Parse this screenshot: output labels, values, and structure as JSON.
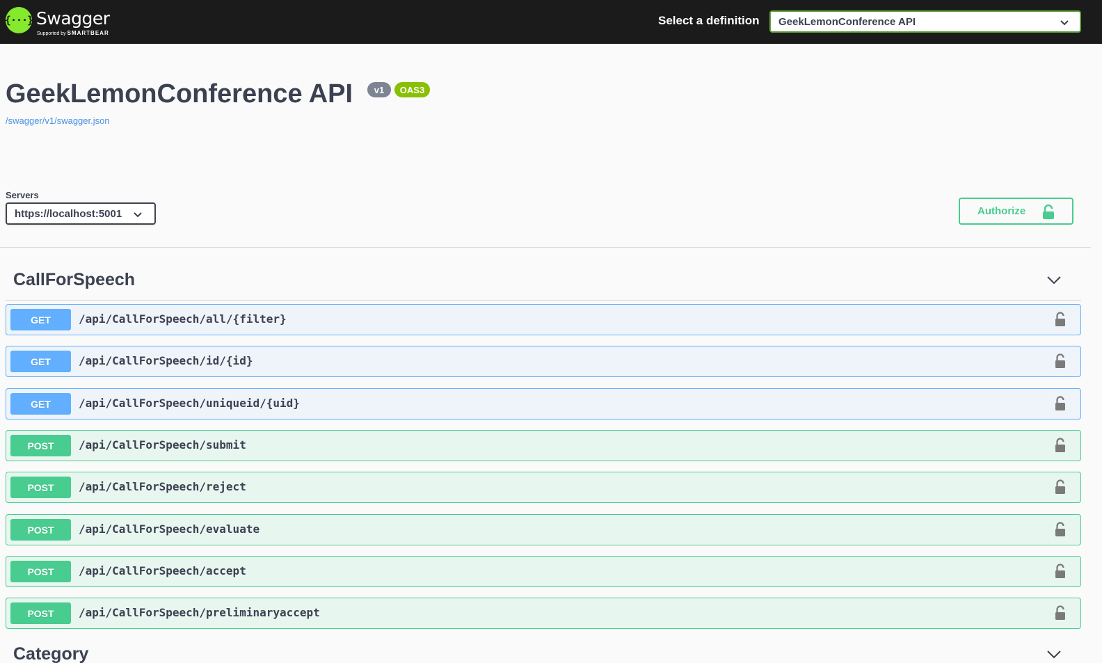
{
  "topbar": {
    "logo_title": "Swagger",
    "logo_supported": "Supported by",
    "logo_brand": "SMARTBEAR",
    "logo_glyph": "{···}",
    "definition_label": "Select a definition",
    "definition_value": "GeekLemonConference API"
  },
  "info": {
    "title": "GeekLemonConference API",
    "version_badge": "v1",
    "spec_badge": "OAS3",
    "spec_link": "/swagger/v1/swagger.json"
  },
  "servers": {
    "label": "Servers",
    "selected": "https://localhost:5001"
  },
  "authorize": {
    "label": "Authorize"
  },
  "tags": [
    {
      "name": "CallForSpeech",
      "operations": [
        {
          "method": "GET",
          "path": "/api/CallForSpeech/all/{filter}"
        },
        {
          "method": "GET",
          "path": "/api/CallForSpeech/id/{id}"
        },
        {
          "method": "GET",
          "path": "/api/CallForSpeech/uniqueid/{uid}"
        },
        {
          "method": "POST",
          "path": "/api/CallForSpeech/submit"
        },
        {
          "method": "POST",
          "path": "/api/CallForSpeech/reject"
        },
        {
          "method": "POST",
          "path": "/api/CallForSpeech/evaluate"
        },
        {
          "method": "POST",
          "path": "/api/CallForSpeech/accept"
        },
        {
          "method": "POST",
          "path": "/api/CallForSpeech/preliminaryaccept"
        }
      ]
    },
    {
      "name": "Category",
      "operations": []
    }
  ],
  "colors": {
    "topbar": "#1b1b1b",
    "logo": "#85ea2d",
    "get": "#61affe",
    "post": "#49cc90",
    "text": "#3b4151",
    "link": "#4990e2"
  },
  "icons": {
    "definition_dropdown": "chevron-down-icon",
    "server_dropdown": "chevron-down-icon",
    "authorize": "unlock-icon",
    "tag_toggle": "chevron-down-icon",
    "operation_lock": "unlock-icon"
  }
}
